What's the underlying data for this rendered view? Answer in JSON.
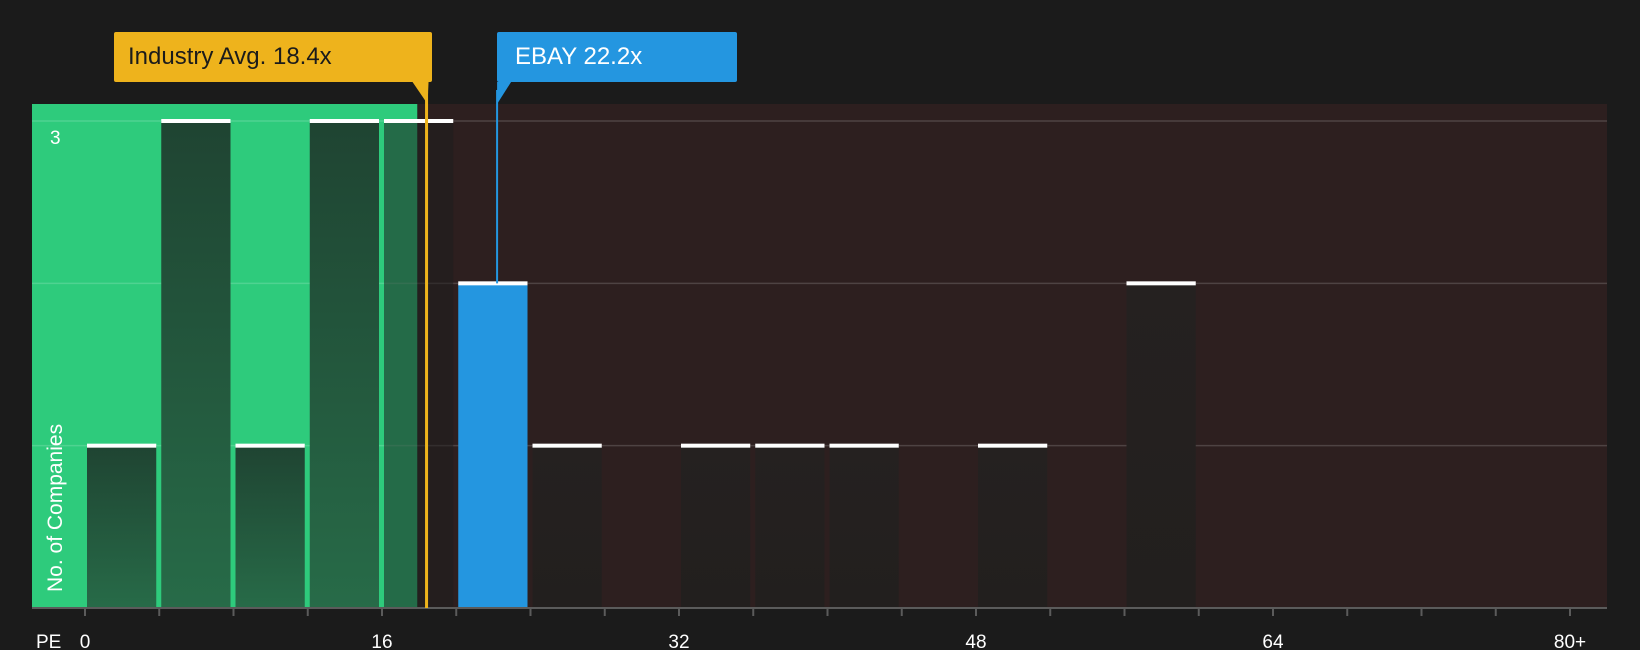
{
  "colors": {
    "background": "#1b1b1b",
    "fair_zone": "#2ecb7c",
    "expensive_zone": "#2d1f1f",
    "company_bar": "#2496e0",
    "industry_avg": "#eeb31c"
  },
  "callouts": {
    "industry_label": "Industry Avg. 18.4x",
    "company_label": "EBAY 22.2x"
  },
  "chart_data": {
    "type": "bar",
    "title": "",
    "xlabel": "PE",
    "ylabel": "No. of Companies",
    "x_tick_labels": [
      "0",
      "16",
      "32",
      "48",
      "64",
      "80+"
    ],
    "x_tick_values": [
      0,
      16,
      32,
      48,
      64,
      80
    ],
    "y_tick_labels": [
      "3"
    ],
    "xlim": [
      -2.9,
      82
    ],
    "ylim": [
      0,
      3.11
    ],
    "bin_width": 4,
    "bins": [
      {
        "start": 0,
        "count": 1
      },
      {
        "start": 4,
        "count": 3
      },
      {
        "start": 8,
        "count": 1
      },
      {
        "start": 12,
        "count": 3
      },
      {
        "start": 16,
        "count": 3
      },
      {
        "start": 20,
        "count": 2,
        "highlight": true
      },
      {
        "start": 24,
        "count": 1
      },
      {
        "start": 32,
        "count": 1
      },
      {
        "start": 36,
        "count": 1
      },
      {
        "start": 40,
        "count": 1
      },
      {
        "start": 48,
        "count": 1
      },
      {
        "start": 56,
        "count": 2
      }
    ],
    "industry_avg": 18.4,
    "company_value": 22.2,
    "fair_zone_end": 17.9,
    "grid": true
  }
}
